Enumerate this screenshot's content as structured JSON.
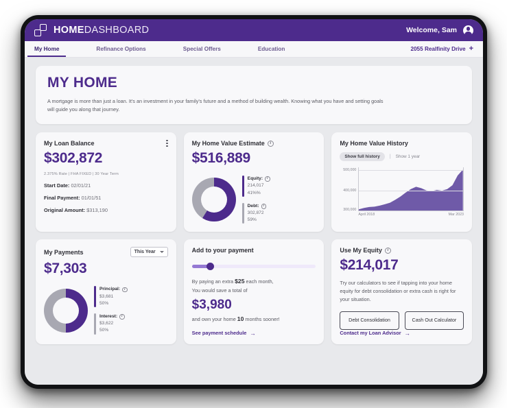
{
  "header": {
    "brand_bold": "HOME",
    "brand_light": "DASHBOARD",
    "welcome": "Welcome, Sam",
    "logo_icon": "two-squares-logo-icon",
    "avatar_icon": "user-avatar-icon"
  },
  "nav": {
    "items": [
      {
        "label": "My Home",
        "active": true
      },
      {
        "label": "Refinance Options",
        "active": false
      },
      {
        "label": "Special Offers",
        "active": false
      },
      {
        "label": "Education",
        "active": false
      }
    ],
    "address": "2055 Realfinity Drive",
    "address_plus": "+"
  },
  "hero": {
    "title": "MY HOME",
    "body": "A mortgage is more than just a loan. It's an investment in your family's future and a method of building wealth. Knowing what you have and setting goals will guide you along that journey."
  },
  "loan_balance": {
    "title": "My Loan Balance",
    "amount": "$302,872",
    "terms": "2.375% Rate | FHA FIXED | 30 Year Term",
    "rows": [
      {
        "label": "Start Date:",
        "value": "02/01/21"
      },
      {
        "label": "Final Payment:",
        "value": "01/01/51"
      },
      {
        "label": "Original Amount:",
        "value": "$313,190"
      }
    ],
    "menu_icon": "kebab-menu-icon"
  },
  "home_value": {
    "title": "My Home Value Estimate",
    "amount": "$516,889",
    "legend": [
      {
        "label": "Equity:",
        "value": "214,017",
        "pct": "41%%",
        "color": "#4d2b8c"
      },
      {
        "label": "Debt:",
        "value": "302,872",
        "pct": "59%",
        "color": "#a8a8b2"
      }
    ]
  },
  "history": {
    "title": "My Home Value History",
    "toggle_active": "Show full history",
    "toggle_sep": "|",
    "toggle_other": "Show 1 year"
  },
  "payments": {
    "title": "My Payments",
    "period": "This Year",
    "amount": "$7,303",
    "legend": [
      {
        "label": "Principal:",
        "value": "$3,681",
        "pct": "50%",
        "color": "#4d2b8c"
      },
      {
        "label": "Interest:",
        "value": "$3,622",
        "pct": "50%",
        "color": "#a8a8b2"
      }
    ]
  },
  "add_payment": {
    "title": "Add to your payment",
    "line1_a": "By paying an extra ",
    "line1_amount": "$25",
    "line1_b": " each month,",
    "line2": "You would save a total of",
    "savings": "$3,980",
    "line3_a": "and own your home ",
    "line3_months": "10",
    "line3_b": " months sooner!",
    "link": "See payment schedule",
    "arrow": "→"
  },
  "equity": {
    "title": "Use My Equity",
    "amount": "$214,017",
    "desc": "Try our calculators to see if tapping into your home equity for debt consolidation or extra cash is right for your situation.",
    "btn1": "Debt Consolidation",
    "btn2": "Cash Out Calculator",
    "link": "Contact my Loan Advisor",
    "arrow": "→"
  },
  "chart_data": {
    "type": "area",
    "title": "My Home Value History",
    "xlabel": "",
    "ylabel": "",
    "ylim": [
      290000,
      512000
    ],
    "yticks": [
      300000,
      400000,
      500000
    ],
    "ytick_labels": [
      "300,000",
      "400,000",
      "500,000"
    ],
    "xtick_labels": [
      "April 2018",
      "Mar 2023"
    ],
    "grid": true,
    "series_color": "#6f5aa8",
    "x": [
      "April 2018",
      "Jul 2018",
      "Oct 2018",
      "Jan 2019",
      "Apr 2019",
      "Jul 2019",
      "Oct 2019",
      "Jan 2020",
      "Apr 2020",
      "Jul 2020",
      "Oct 2020",
      "Jan 2021",
      "Apr 2021",
      "Jul 2021",
      "Oct 2021",
      "Jan 2022",
      "Apr 2022",
      "Jul 2022",
      "Oct 2022",
      "Jan 2023",
      "Mar 2023"
    ],
    "values": [
      296000,
      303000,
      308000,
      310000,
      315000,
      322000,
      330000,
      345000,
      362000,
      382000,
      400000,
      412000,
      405000,
      393000,
      390000,
      396000,
      392000,
      400000,
      420000,
      470000,
      500000
    ]
  }
}
